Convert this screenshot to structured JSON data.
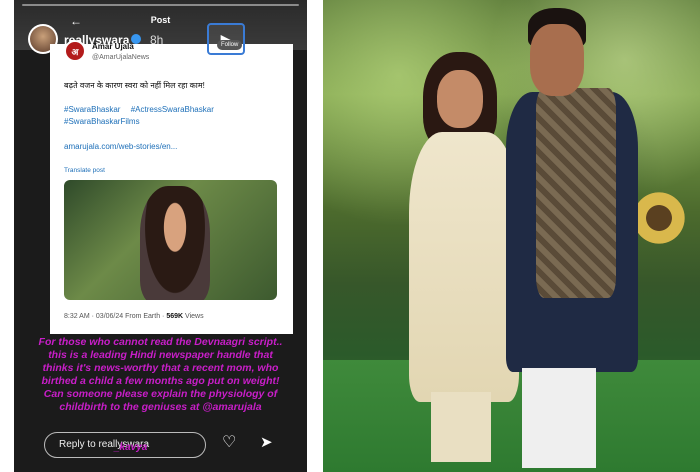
{
  "story": {
    "header_title": "Post",
    "username": "reallyswara",
    "age": "8h",
    "follow_label": "Follow",
    "source": {
      "name": "Amar Ujala",
      "handle": "@AmarUjalaNews",
      "logo_text": "अ"
    },
    "post_text": "बढ़ते वजन के कारण स्वरा को नहीं मिल रहा काम!",
    "hashtags": [
      "#SwaraBhaskar",
      "#ActressSwaraBhaskar",
      "#SwaraBhaskarFilms"
    ],
    "link": "amarujala.com/web-stories/en...",
    "translate_label": "Translate post",
    "meta": {
      "time": "8:32 AM · 03/06/24 From Earth ·",
      "views": "569K",
      "views_label": "Views"
    },
    "overlay_text": "For those who cannot read the Devnaagri script.. this is a leading Hindi newspaper handle that thinks it's news-worthy that a recent mom, who birthed a child a few months ago put on weight! Can someone please explain the physiology of childbirth to the geniuses at @amarujala",
    "reply_placeholder": "Reply to reallyswara",
    "reply_mention": "_kavya",
    "icons": [
      "back-arrow-icon",
      "play-icon",
      "heart-icon",
      "send-icon",
      "verified-icon"
    ]
  },
  "colors": {
    "overlay_text": "#c81ec8",
    "link": "#1d6fb8",
    "highlight_border": "#3a7bd5"
  }
}
